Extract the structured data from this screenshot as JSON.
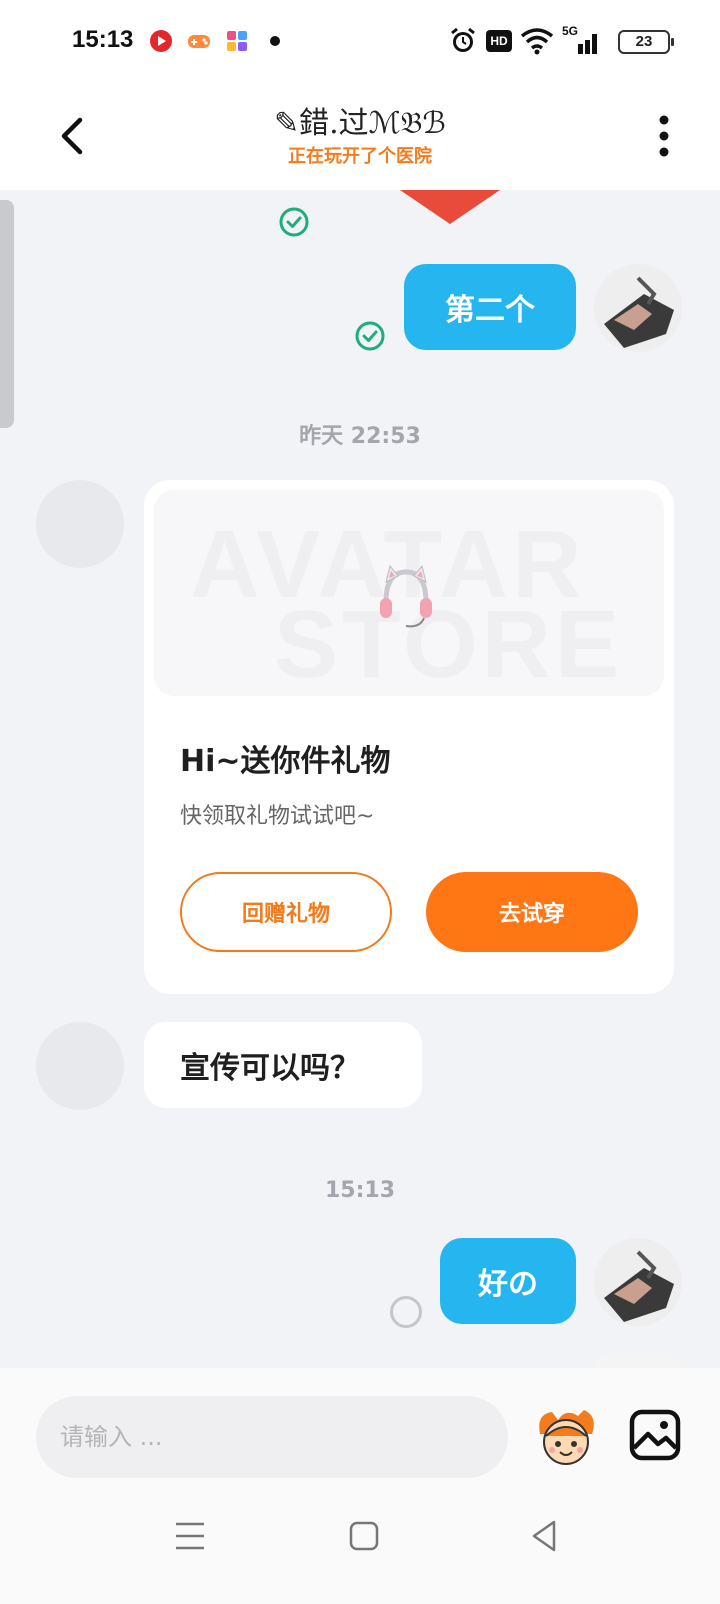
{
  "status_bar": {
    "time": "15:13",
    "network": "5G",
    "hd": "HD",
    "battery": "23"
  },
  "header": {
    "title": "✎錯.过ℳ𝔅ℬ",
    "status": "正在玩开了个医院",
    "icons": {
      "back": "back-chevron-icon",
      "more": "more-vertical-icon"
    }
  },
  "messages": {
    "msg1": {
      "text": "第二个",
      "sender": "self"
    },
    "timestamp1": "昨天 22:53",
    "gift_card": {
      "banner_line1": "AVATAR",
      "banner_line2": "STORE",
      "title": "Hi~送你件礼物",
      "subtitle": "快领取礼物试试吧~",
      "return_label": "回赠礼物",
      "try_label": "去试穿"
    },
    "msg2": {
      "text": "宣传可以吗？",
      "sender": "other"
    },
    "timestamp2": "15:13",
    "msg3": {
      "text": "好の",
      "sender": "self"
    }
  },
  "input": {
    "placeholder": "请输入 ..."
  },
  "colors": {
    "bubble_self": "#25b6ef",
    "accent_orange": "#ff7614",
    "status_orange": "#f47c1d",
    "check_green": "#1fae7a",
    "background": "#f2f3f7"
  }
}
